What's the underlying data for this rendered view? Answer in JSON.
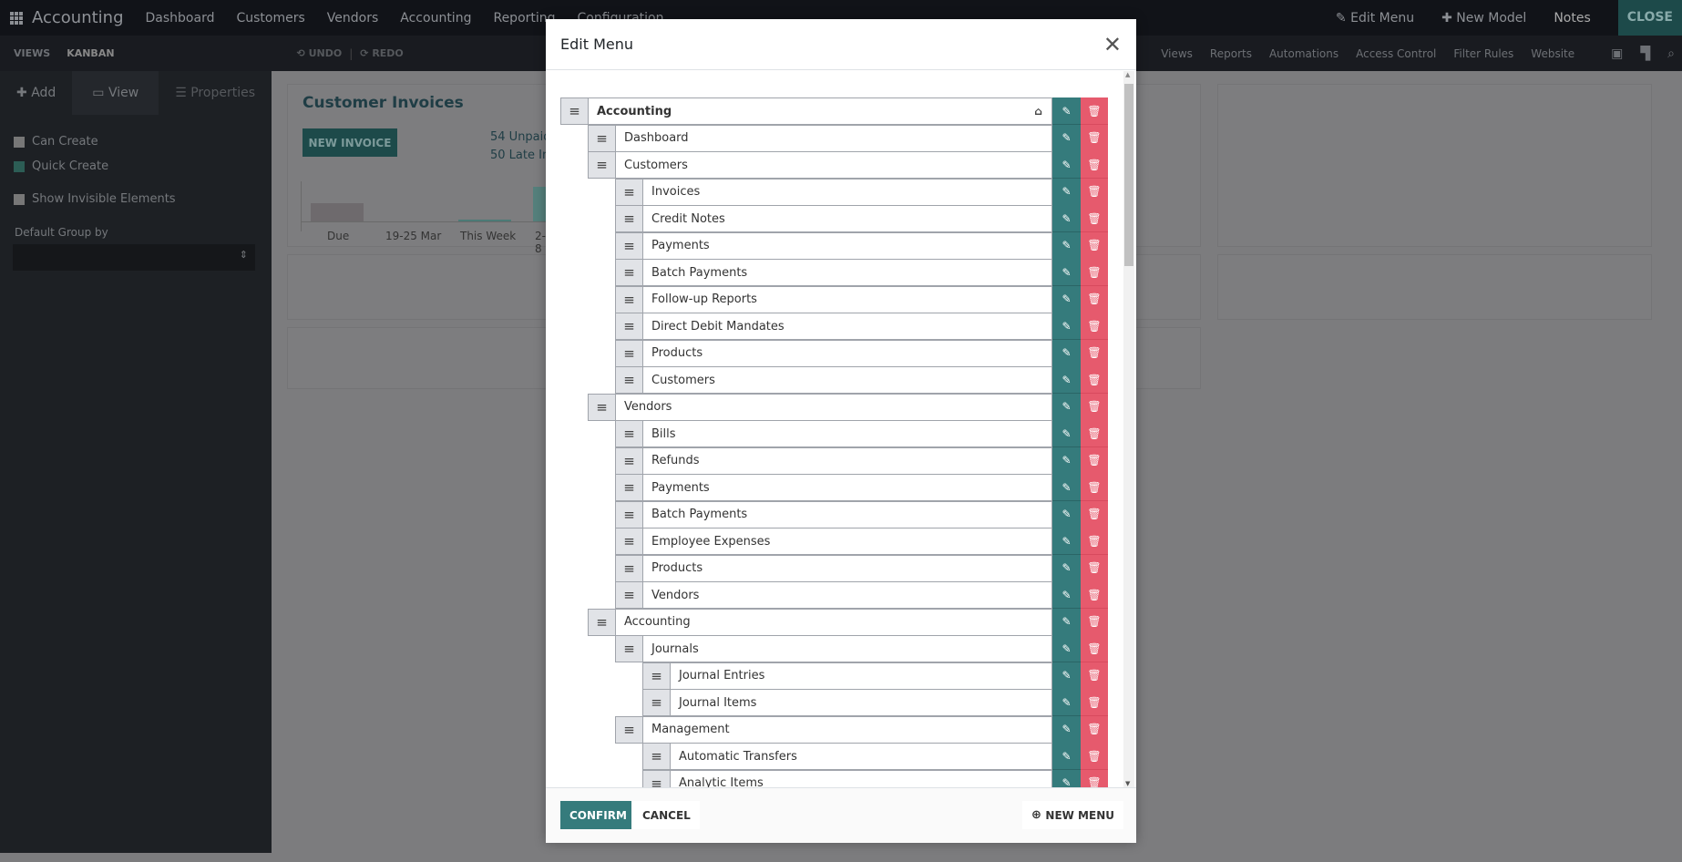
{
  "topbar": {
    "app": "Accounting",
    "nav": [
      "Dashboard",
      "Customers",
      "Vendors",
      "Accounting",
      "Reporting",
      "Configuration"
    ],
    "edit_menu": "Edit Menu",
    "new_model": "New Model",
    "notes": "Notes",
    "close": "CLOSE"
  },
  "subbar": {
    "views": "VIEWS",
    "kanban": "KANBAN",
    "undo": "UNDO",
    "redo": "REDO",
    "links": [
      "Views",
      "Reports",
      "Automations",
      "Access Control",
      "Filter Rules",
      "Website"
    ]
  },
  "sidebar": {
    "tabs": [
      "Add",
      "View",
      "Properties"
    ],
    "can_create": "Can Create",
    "quick_create": "Quick Create",
    "show_invisible": "Show Invisible Elements",
    "default_group": "Default Group by"
  },
  "background": {
    "card_title": "Customer Invoices",
    "new_invoice": "NEW INVOICE",
    "stat1": "54 Unpaid",
    "stat2": "50 Late Inv",
    "chart_labels": [
      "Due",
      "19-25 Mar",
      "This Week",
      "2-8"
    ]
  },
  "modal": {
    "title": "Edit Menu",
    "confirm": "CONFIRM",
    "cancel": "CANCEL",
    "new_menu": "NEW MENU",
    "items": [
      {
        "label": "Accounting",
        "level": 0,
        "home": true
      },
      {
        "label": "Dashboard",
        "level": 1
      },
      {
        "label": "Customers",
        "level": 1
      },
      {
        "label": "Invoices",
        "level": 2
      },
      {
        "label": "Credit Notes",
        "level": 2
      },
      {
        "label": "Payments",
        "level": 2
      },
      {
        "label": "Batch Payments",
        "level": 2
      },
      {
        "label": "Follow-up Reports",
        "level": 2
      },
      {
        "label": "Direct Debit Mandates",
        "level": 2
      },
      {
        "label": "Products",
        "level": 2
      },
      {
        "label": "Customers",
        "level": 2
      },
      {
        "label": "Vendors",
        "level": 1
      },
      {
        "label": "Bills",
        "level": 2
      },
      {
        "label": "Refunds",
        "level": 2
      },
      {
        "label": "Payments",
        "level": 2
      },
      {
        "label": "Batch Payments",
        "level": 2
      },
      {
        "label": "Employee Expenses",
        "level": 2
      },
      {
        "label": "Products",
        "level": 2
      },
      {
        "label": "Vendors",
        "level": 2
      },
      {
        "label": "Accounting",
        "level": 1
      },
      {
        "label": "Journals",
        "level": 2
      },
      {
        "label": "Journal Entries",
        "level": 3
      },
      {
        "label": "Journal Items",
        "level": 3
      },
      {
        "label": "Management",
        "level": 2
      },
      {
        "label": "Automatic Transfers",
        "level": 3
      },
      {
        "label": "Analytic Items",
        "level": 3
      }
    ]
  },
  "colors": {
    "edit": "#357b7c",
    "delete": "#e65a6d",
    "accent": "#357b7c"
  }
}
